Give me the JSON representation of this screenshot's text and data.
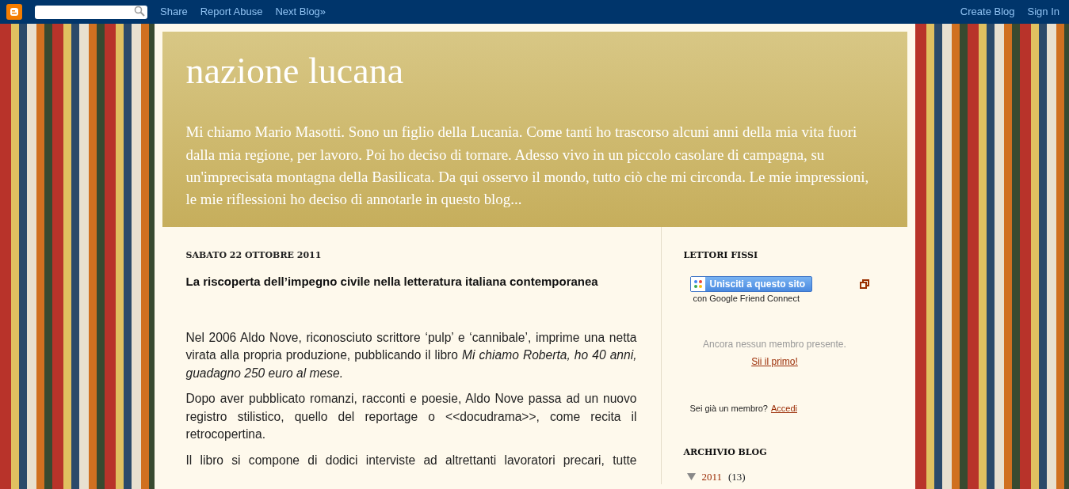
{
  "navbar": {
    "links": [
      "Share",
      "Report Abuse",
      "Next Blog»"
    ],
    "right_links": [
      "Create Blog",
      "Sign In"
    ]
  },
  "header": {
    "title": "nazione lucana",
    "description": "Mi chiamo Mario Masotti. Sono un figlio della Lucania. Come tanti ho trascorso alcuni anni della mia vita fuori dalla mia regione, per lavoro. Poi ho deciso di tornare. Adesso vivo in un piccolo casolare di campagna, su un'imprecisata montagna della Basilicata. Da qui osservo il mondo, tutto ciò che mi circonda. Le mie impressioni, le mie riflessioni ho deciso di annotarle in questo blog..."
  },
  "post": {
    "date": "SABATO 22 OTTOBRE 2011",
    "title": "La riscoperta dell’impegno civile nella letteratura italiana contemporanea",
    "paragraphs": [
      "Nel 2006 Aldo Nove, riconosciuto scrittore ‘pulp’ e ‘cannibale’, imprime una netta virata alla propria produzione, pubblicando il libro *Mi chiamo Roberta, ho 40 anni, guadagno 250 euro al mese.*",
      "Dopo aver pubblicato romanzi, racconti e poesie, Aldo Nove passa ad un nuovo registro stilistico, quello del reportage o <<docudrama>>, come recita il retrocopertina.",
      "Il libro si compone di dodici interviste ad altrettanti lavoratori precari, tutte"
    ]
  },
  "sidebar": {
    "followers": {
      "heading": "LETTORI FISSI",
      "join_button": "Unisciti a questo sito",
      "join_caption": "con Google Friend Connect",
      "empty_text": "Ancora nessun membro presente.",
      "first_link": "Sii il primo!",
      "member_question": "Sei già un membro?",
      "signin_link": "Accedi"
    },
    "archive": {
      "heading": "ARCHIVIO BLOG",
      "items": [
        {
          "year": "2011",
          "count": "(13)",
          "expanded": true
        }
      ]
    }
  }
}
